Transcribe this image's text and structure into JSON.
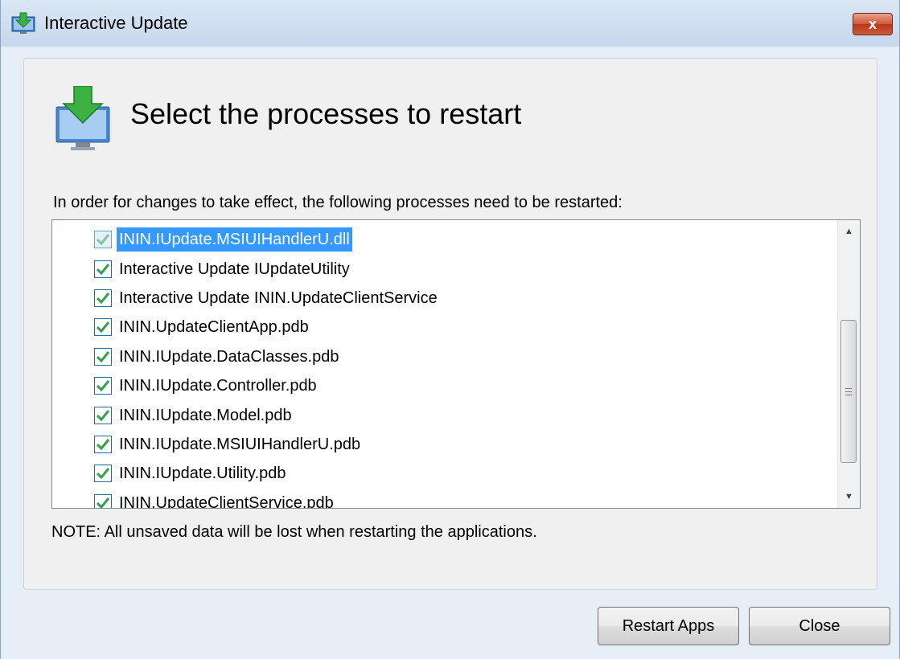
{
  "window": {
    "title": "Interactive Update",
    "close_glyph": "x",
    "icon": "download-monitor-icon"
  },
  "header": {
    "title": "Select the processes to restart",
    "icon": "download-monitor-icon"
  },
  "instruction": "In order for changes to take effect, the following processes need to be restarted:",
  "processes": [
    {
      "label": "ININ.IUpdate.MSIUIHandlerU.dll",
      "checked": true,
      "selected": true
    },
    {
      "label": "Interactive Update IUpdateUtility",
      "checked": true,
      "selected": false
    },
    {
      "label": "Interactive Update ININ.UpdateClientService",
      "checked": true,
      "selected": false
    },
    {
      "label": "ININ.UpdateClientApp.pdb",
      "checked": true,
      "selected": false
    },
    {
      "label": "ININ.IUpdate.DataClasses.pdb",
      "checked": true,
      "selected": false
    },
    {
      "label": "ININ.IUpdate.Controller.pdb",
      "checked": true,
      "selected": false
    },
    {
      "label": "ININ.IUpdate.Model.pdb",
      "checked": true,
      "selected": false
    },
    {
      "label": "ININ.IUpdate.MSIUIHandlerU.pdb",
      "checked": true,
      "selected": false
    },
    {
      "label": "ININ.IUpdate.Utility.pdb",
      "checked": true,
      "selected": false
    },
    {
      "label": "ININ.UpdateClientService.pdb",
      "checked": true,
      "selected": false
    }
  ],
  "note": "NOTE: All unsaved data will be lost when restarting the applications.",
  "buttons": {
    "restart": "Restart Apps",
    "close": "Close"
  },
  "colors": {
    "selection": "#3399ff",
    "check": "#2fa34a",
    "close_button": "#c7432a"
  }
}
